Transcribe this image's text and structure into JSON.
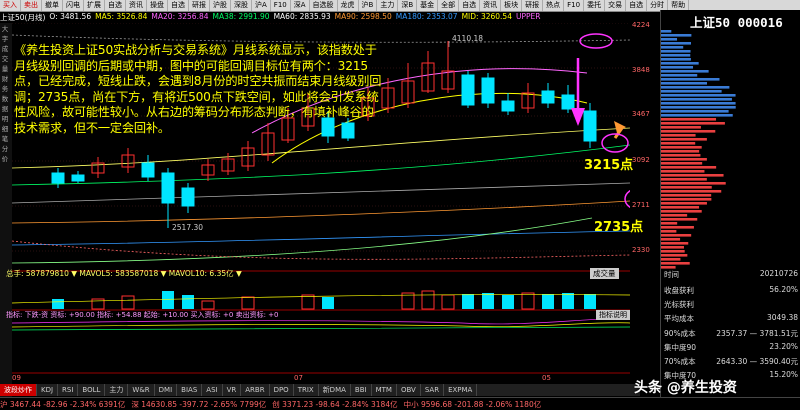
{
  "toolbar": {
    "items": [
      "买入",
      "卖出",
      "撤单",
      "闪电",
      "扩展",
      "自选",
      "资讯",
      "操盘",
      "自选",
      "研报",
      "沪股",
      "深股",
      "沪A",
      "F10",
      "深A",
      "自选股",
      "龙虎",
      "沪B",
      "主力",
      "深B",
      "基金",
      "全部",
      "自选",
      "资讯",
      "板块",
      "研报",
      "热点",
      "F10",
      "委托",
      "交易",
      "自选",
      "分时",
      "帮助"
    ]
  },
  "ma_line": {
    "title": "上证50(月线)",
    "open": "O: 3481.56",
    "ma5": "MA5: 3526.84",
    "ma20": "MA20: 3256.84",
    "ma38": "MA38: 2991.90",
    "ma60": "MA60: 2835.93",
    "ma90": "MA90: 2598.50",
    "ma180": "MA180: 2353.07",
    "mid": "MID: 3260.54",
    "upper": "UPPER"
  },
  "colors": {
    "up": "#ff3030",
    "down": "#00e5ff",
    "annotation": "#ffff00",
    "circle": "#ff33ff",
    "arrow_down": "#ff33ff",
    "arrow_up": "#ff9933"
  },
  "annotation": {
    "text": "《养生投资上证50实战分析与交易系统》月线系统显示，该指数处于月线级别回调的后期或中期，图中的可能回调目标位有两个：3215点，已经完成，短线止跌，会遇到8月份的时空共振而结束月线级别回调；2735点，尚在下方，有将近500点下跌空间，如此将会引发系统性风险，故可能性较小。从右边的筹码分布形态判断，有填补峰谷的技术需求，但不一定会回补。",
    "label_3215": "3215点",
    "label_2735": "2735点"
  },
  "price_labels": {
    "high": "4110.18",
    "low": "2517.30"
  },
  "axis": {
    "ticks": [
      "4224",
      "3848",
      "3467",
      "3092",
      "2711",
      "2330"
    ]
  },
  "left_strip": [
    "大",
    "字",
    "成",
    "交",
    "量",
    "财",
    "务",
    "数",
    "据",
    "明",
    "细",
    "笔",
    "分",
    "价"
  ],
  "right_panel": {
    "title": "上证50 000016",
    "time_label": "时间",
    "time_value": "20210726",
    "profit_label": "收盘获利",
    "profit_value": "56.20%",
    "light_label": "光标获利",
    "light_value": "",
    "avg_label": "平均成本",
    "avg_value": "3049.38",
    "c90_label": "90%成本",
    "c90_value": "2357.37 — 3781.51元",
    "conc90_label": "集中度90",
    "conc90_value": "23.20%",
    "c70_label": "70%成本",
    "c70_value": "2643.30 — 3590.40元",
    "conc70_label": "集中度70",
    "conc70_value": "15.20%"
  },
  "volume": {
    "line": "总手: 587879810 ▼  MAVOL5: 583587018 ▼  MAVOL10: 6.35亿 ▼",
    "dropdown": "成交量"
  },
  "indicator": {
    "line": "指标: 下跌-资  资标: +90.00  指标: +54.88  起始: +10.00  买入资标: +0 卖出资标: +0",
    "explain": "指标说明"
  },
  "tabs": [
    "波段炒作",
    "KDJ",
    "RSI",
    "BOLL",
    "主力",
    "W&R",
    "DMI",
    "BIAS",
    "ASI",
    "VR",
    "ARBR",
    "DPO",
    "TRIX",
    "新DMA",
    "BBI",
    "MTM",
    "OBV",
    "SAR",
    "EXPMA"
  ],
  "bottom": {
    "sh": "沪 3467.44  -82.96  -2.34%  6391亿",
    "sz": "深 14630.85  -397.72  -2.65%  7799亿",
    "cy": "创 3371.23  -98.64  -2.84%  3184亿",
    "zx": "中小 9596.68  -201.88  -2.06%  1180亿"
  },
  "watermark": "头条 @养生投资"
}
